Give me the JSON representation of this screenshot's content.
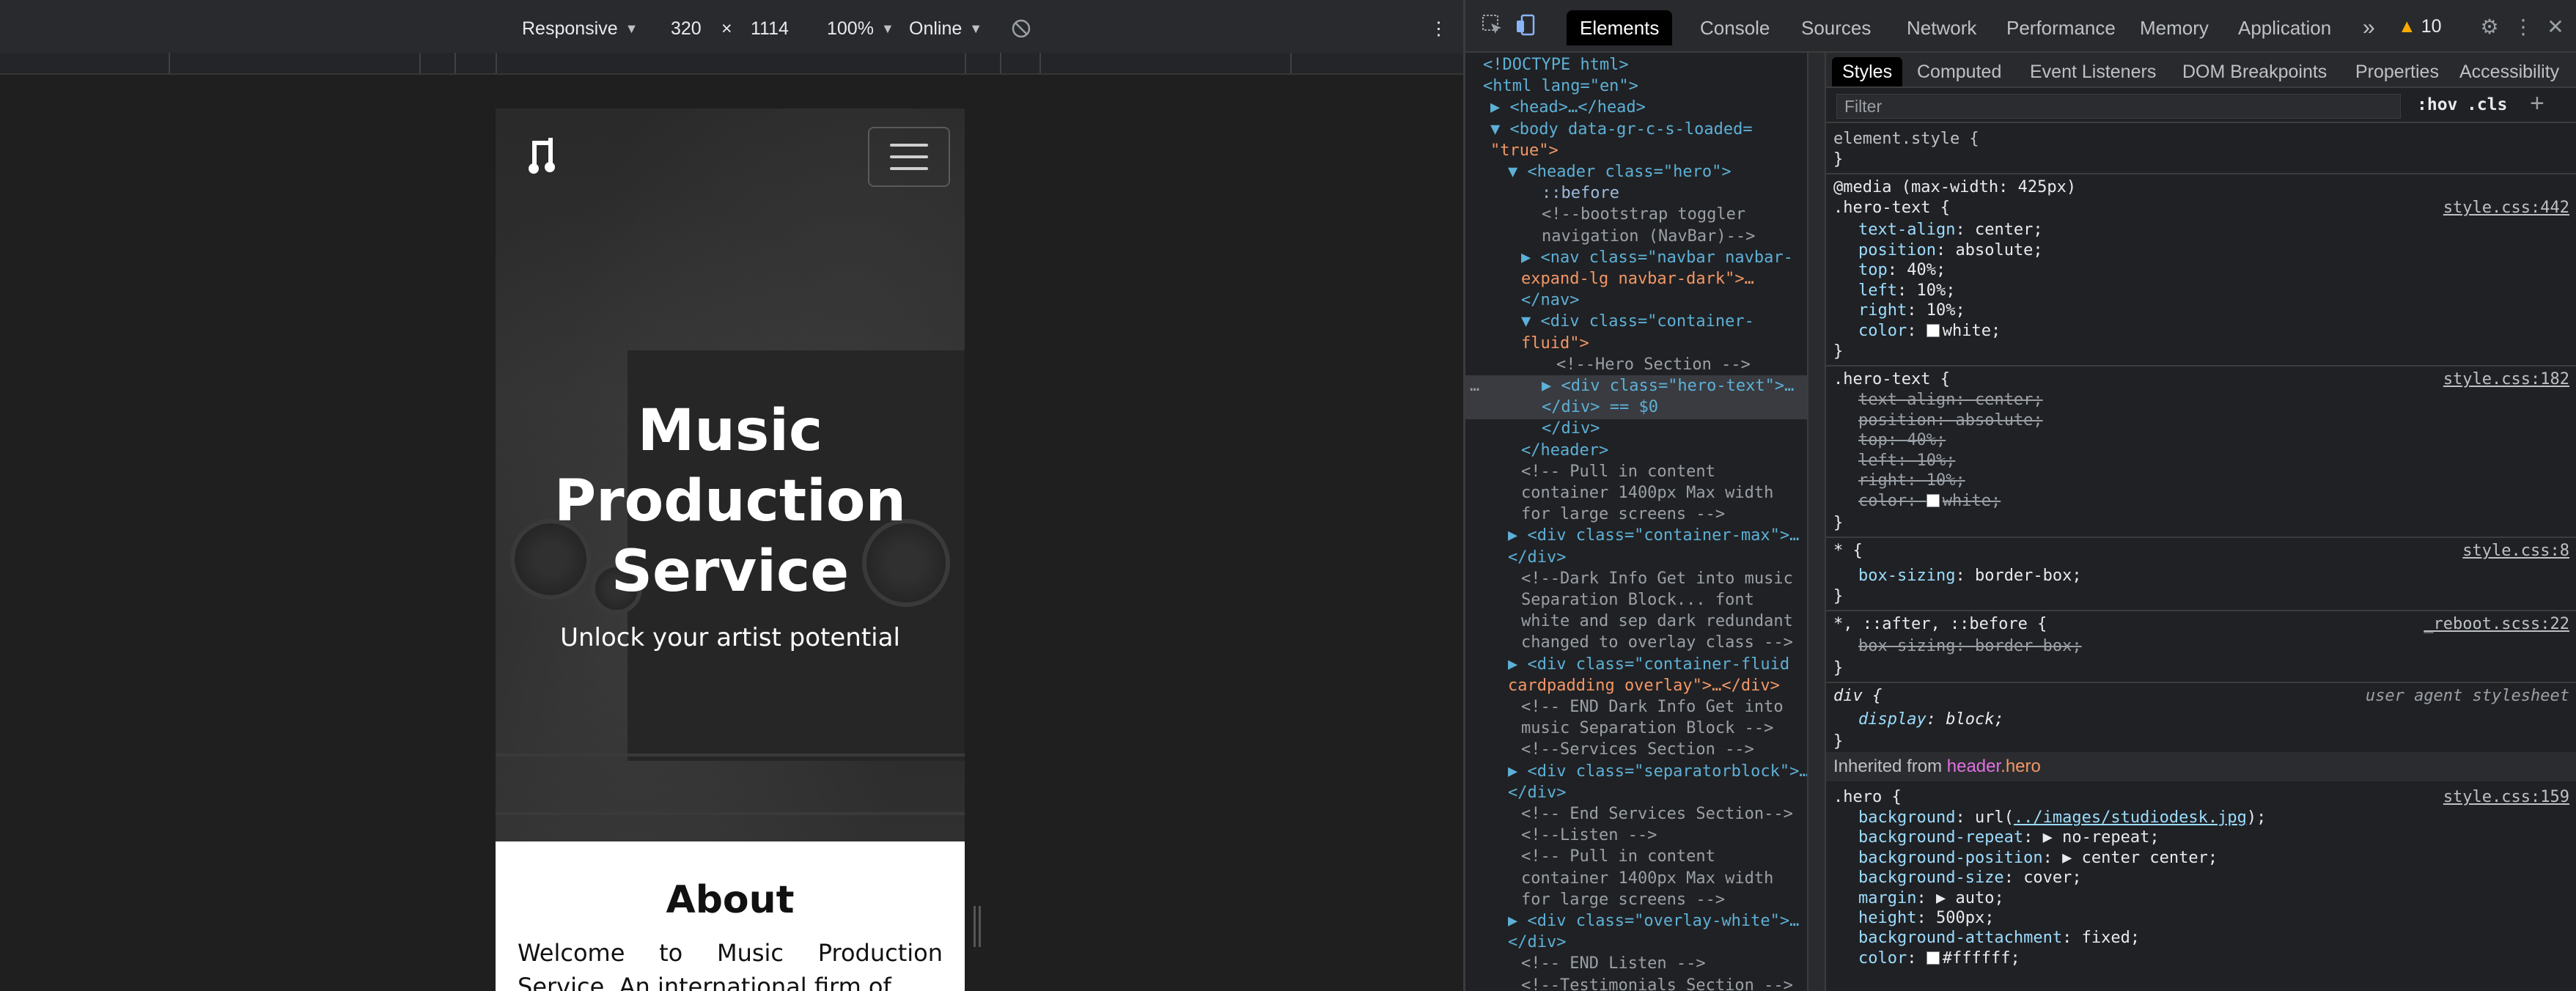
{
  "device_toolbar": {
    "device": "Responsive",
    "width": "320",
    "times": "×",
    "height": "1114",
    "zoom": "100%",
    "network": "Online",
    "caret": "▼",
    "more": "⋮"
  },
  "page": {
    "hero_title_lines": [
      "Music",
      "Production",
      "Service"
    ],
    "hero_subtitle": "Unlock your artist potential",
    "about_heading": "About",
    "about_text_line1": "Welcome to Music Production",
    "about_text_line2": "Service. An international firm of"
  },
  "devtools": {
    "tabs": [
      "Elements",
      "Console",
      "Sources",
      "Network",
      "Performance",
      "Memory",
      "Application"
    ],
    "active_tab": "Elements",
    "overflow": "»",
    "warnings": "10",
    "styles_tabs": [
      "Styles",
      "Computed",
      "Event Listeners",
      "DOM Breakpoints",
      "Properties",
      "Accessibility"
    ],
    "filter_placeholder": "Filter",
    "hov": ":hov",
    "cls": ".cls",
    "add": "+"
  },
  "dom_tree": [
    {
      "text": "<!DOCTYPE html>"
    },
    {
      "text": "<html lang=\"en\">"
    },
    {
      "text": "▶ <head>…</head>"
    },
    {
      "text": "▼ <body data-gr-c-s-loaded="
    },
    {
      "text": "\"true\">"
    },
    {
      "text": "▼ <header class=\"hero\">"
    },
    {
      "text": "::before"
    },
    {
      "text": "<!--bootstrap toggler"
    },
    {
      "text": "navigation (NavBar)-->"
    },
    {
      "text": "▶ <nav class=\"navbar navbar-"
    },
    {
      "text": "expand-lg navbar-dark\">…"
    },
    {
      "text": "</nav>"
    },
    {
      "text": "▼ <div class=\"container-"
    },
    {
      "text": "fluid\">"
    },
    {
      "text": "<!--Hero Section -->"
    },
    {
      "text": "▶ <div class=\"hero-text\">…"
    },
    {
      "text": "</div> == $0"
    },
    {
      "text": "</div>"
    },
    {
      "text": "</header>"
    },
    {
      "text": "<!-- Pull in content"
    },
    {
      "text": "container 1400px Max width"
    },
    {
      "text": "for large screens -->"
    },
    {
      "text": "▶ <div class=\"container-max\">…"
    },
    {
      "text": "</div>"
    },
    {
      "text": "<!--Dark Info Get into music"
    },
    {
      "text": "Separation Block... font"
    },
    {
      "text": "white and sep dark redundant"
    },
    {
      "text": "changed to overlay class -->"
    },
    {
      "text": "▶ <div class=\"container-fluid"
    },
    {
      "text": "cardpadding overlay\">…</div>"
    },
    {
      "text": "<!-- END Dark Info Get into"
    },
    {
      "text": "music Separation Block -->"
    },
    {
      "text": "<!--Services Section -->"
    },
    {
      "text": "▶ <div class=\"separatorblock\">…"
    },
    {
      "text": "</div>"
    },
    {
      "text": "<!-- End Services Section-->"
    },
    {
      "text": "<!--Listen -->"
    },
    {
      "text": "<!-- Pull in content"
    },
    {
      "text": "container 1400px Max width"
    },
    {
      "text": "for large screens -->"
    },
    {
      "text": "▶ <div class=\"overlay-white\">…"
    },
    {
      "text": "</div>"
    },
    {
      "text": "<!-- END Listen -->"
    },
    {
      "text": "<!--Testimonials Section -->"
    }
  ],
  "dom_selected_ellipsis": "…",
  "styles": {
    "element_style": "element.style {",
    "close": "}",
    "media_query": "@media (max-width: 425px)",
    "rule1_selector": ".hero-text {",
    "rule1_source": "style.css:442",
    "rule1_props": [
      {
        "p": "text-align",
        "v": "center;"
      },
      {
        "p": "position",
        "v": "absolute;"
      },
      {
        "p": "top",
        "v": "40%;"
      },
      {
        "p": "left",
        "v": "10%;"
      },
      {
        "p": "right",
        "v": "10%;"
      },
      {
        "p": "color",
        "v": "white;"
      }
    ],
    "rule2_selector": ".hero-text {",
    "rule2_source": "style.css:182",
    "rule2_props": [
      {
        "p": "text-align",
        "v": "center;"
      },
      {
        "p": "position",
        "v": "absolute;"
      },
      {
        "p": "top",
        "v": "40%;"
      },
      {
        "p": "left",
        "v": "10%;"
      },
      {
        "p": "right",
        "v": "10%;"
      },
      {
        "p": "color",
        "v": "white;"
      }
    ],
    "rule3_selector": "* {",
    "rule3_source": "style.css:8",
    "rule3_prop": {
      "p": "box-sizing",
      "v": "border-box;"
    },
    "rule4_selector": "*, ::after, ::before {",
    "rule4_source": "_reboot.scss:22",
    "rule4_prop": {
      "p": "box-sizing",
      "v": "border-box;"
    },
    "rule5_selector": "div {",
    "rule5_source": "user agent stylesheet",
    "rule5_prop": {
      "p": "display",
      "v": "block;"
    },
    "inherited_label": "Inherited from",
    "inherited_tag": "header",
    "inherited_class": ".hero",
    "rule6_selector": ".hero {",
    "rule6_source": "style.css:159",
    "rule6_props": [
      {
        "p": "background",
        "v": "url(../images/studiodesk.jpg);"
      },
      {
        "p": "background-repeat",
        "v": "▶ no-repeat;"
      },
      {
        "p": "background-position",
        "v": "▶ center center;"
      },
      {
        "p": "background-size",
        "v": "cover;"
      },
      {
        "p": "margin",
        "v": "▶ auto;"
      },
      {
        "p": "height",
        "v": "500px;"
      },
      {
        "p": "background-attachment",
        "v": "fixed;"
      },
      {
        "p": "color",
        "v": "#ffffff;"
      }
    ]
  },
  "colors": {
    "dt_bg": "#202124",
    "tag": "#5db0d7",
    "attr_value": "#f29766",
    "prop": "#9cdcfe",
    "warning": "#f9ab00"
  }
}
